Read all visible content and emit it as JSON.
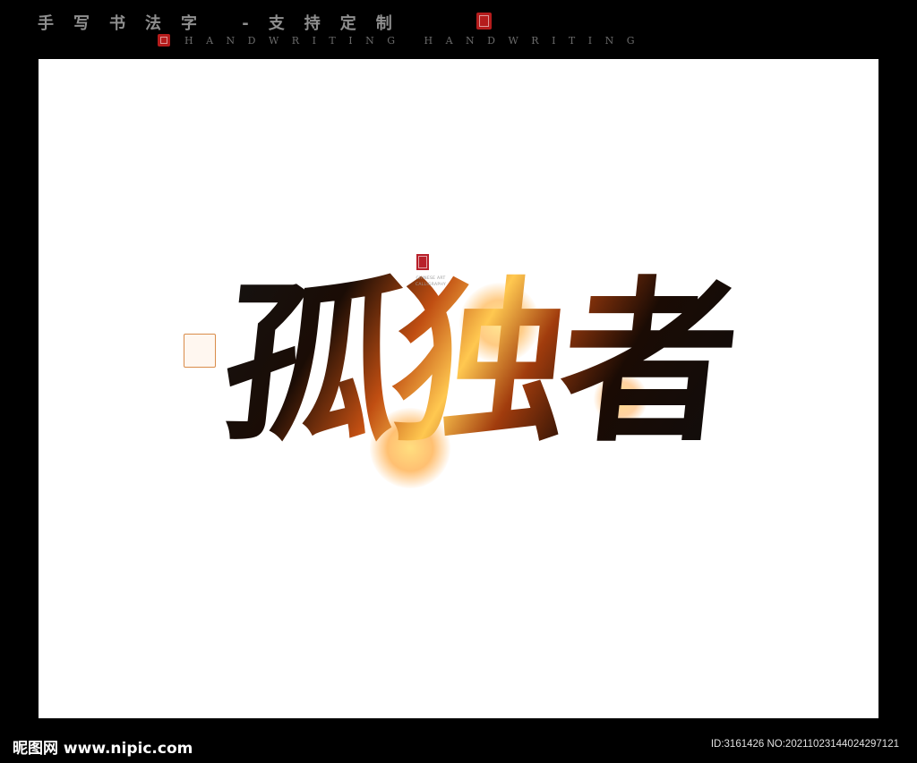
{
  "header": {
    "title": "手写书法字 -支持定制",
    "subtitle": "HANDWRITING HANDWRITING"
  },
  "artwork": {
    "calligraphy": "孤独者",
    "caption": "CHINESE ART CALLIGRAPHY"
  },
  "footer": {
    "logo": "昵图网 www.nipic.com",
    "id": "ID:3161426 NO:20211023144024297121"
  },
  "colors": {
    "background": "#000000",
    "canvas": "#ffffff",
    "seal": "#b51c1c",
    "glow": "#ffb830"
  }
}
